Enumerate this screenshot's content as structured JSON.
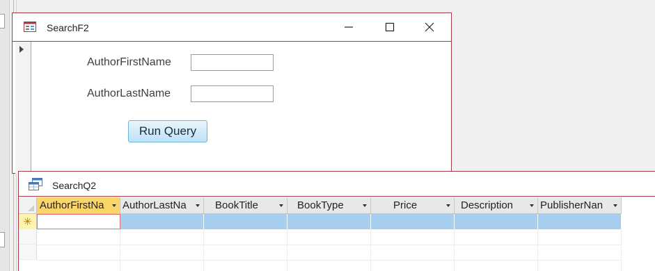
{
  "form": {
    "title": "SearchF2",
    "fields": [
      {
        "label": "AuthorFirstName",
        "value": ""
      },
      {
        "label": "AuthorLastName",
        "value": ""
      }
    ],
    "run_button": "Run Query"
  },
  "query": {
    "title": "SearchQ2",
    "columns": [
      "AuthorFirstNa",
      "AuthorLastNa",
      "BookTitle",
      "BookType",
      "Price",
      "Description",
      "PublisherNan"
    ],
    "new_record_symbol": "✳"
  },
  "colors": {
    "window_border": "#a7394b",
    "active_header": "#fbd46a",
    "new_row": "#a7cdf0"
  }
}
